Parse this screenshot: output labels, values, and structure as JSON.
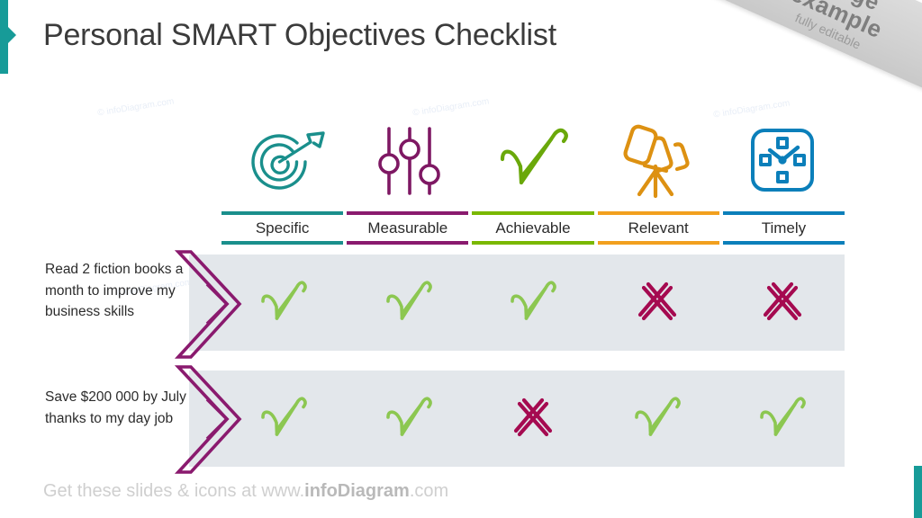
{
  "title": "Personal SMART Objectives Checklist",
  "ribbon": {
    "line1": "Usage",
    "line2": "example",
    "line3": "fully editable"
  },
  "watermark": "© infoDiagram.com",
  "colors": {
    "specific": "#1a8f8c",
    "measurable": "#8a1a6e",
    "achievable": "#7ab800",
    "relevant": "#f2a01e",
    "timely": "#0b7fba",
    "check": "#8cc751",
    "cross": "#a50a50",
    "arrow": "#8a1a6e",
    "band": "#e3e7eb",
    "accent_bar": "#179b98"
  },
  "columns": [
    {
      "label": "Specific",
      "color": "#1a8f8c",
      "icon": "target-icon"
    },
    {
      "label": "Measurable",
      "color": "#8a1a6e",
      "icon": "sliders-icon"
    },
    {
      "label": "Achievable",
      "color": "#7ab800",
      "icon": "checkmark-icon"
    },
    {
      "label": "Relevant",
      "color": "#f2a01e",
      "icon": "telescope-icon"
    },
    {
      "label": "Timely",
      "color": "#0b7fba",
      "icon": "clock-icon"
    }
  ],
  "rows": [
    {
      "label": "Read 2 fiction books a month to improve my business skills",
      "marks": [
        "check",
        "check",
        "check",
        "cross",
        "cross"
      ]
    },
    {
      "label": "Save $200 000 by July thanks to my day job",
      "marks": [
        "check",
        "check",
        "cross",
        "check",
        "check"
      ]
    }
  ],
  "footer": {
    "prefix": "Get these slides & icons at www.",
    "brand": "infoDiagram",
    "suffix": ".com"
  }
}
